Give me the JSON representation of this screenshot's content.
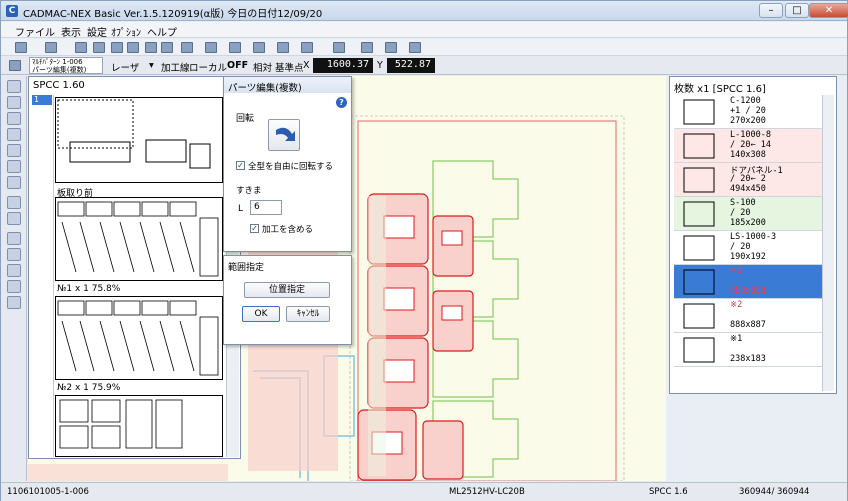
{
  "window": {
    "title": "CADMAC-NEX Basic Ver.1.5.120919(α版) 今日の日付12/09/20",
    "controls": [
      "minimize-icon",
      "maximize-icon",
      "close-icon"
    ]
  },
  "menu": [
    "ファイル",
    "表示",
    "設定",
    "ｵﾌﾟｼｮﾝ",
    "ヘルプ"
  ],
  "statusline": {
    "combo_line1": "ﾏﾙﾁﾊﾟﾀｰﾝ 1-006",
    "combo_line2": "パーツ編集(複数)",
    "machine": "レーザ",
    "processing": "加工線",
    "local": "ローカル",
    "off": "OFF",
    "relative": "相対",
    "base_point": "基準点",
    "x_label": "X",
    "x_value": "1600.37",
    "y_label": "Y",
    "y_value": "522.87"
  },
  "sheet_panel": {
    "title": "SPCC  1.60",
    "row_number": "1",
    "sheets": [
      {
        "label": "板取り前"
      },
      {
        "label": "№1  x  1    75.8%"
      },
      {
        "label": "№2  x  1    75.9%"
      }
    ]
  },
  "parts_dialog": {
    "title": "パーツ編集(複数)",
    "help": "?",
    "rotate_label": "回転",
    "rotate_free": "全型を自由に回転する",
    "offset_label": "すきま",
    "offset_prefix": "L",
    "offset_value": "6",
    "include_processing": "加工を含める"
  },
  "range_dialog": {
    "title": "範囲指定",
    "position_button": "位置指定",
    "ok": "OK",
    "cancel": "ｷｬﾝｾﾙ"
  },
  "list_panel": {
    "title": "枚数 x1 [SPCC 1.6]",
    "items": [
      {
        "name": "C-1200",
        "qty": "+1  /  20",
        "size": "270x200",
        "bg": "#ffffff",
        "color": "#000000"
      },
      {
        "name": "L-1000-8",
        "qty": " /  20←  14",
        "size": "140x308",
        "bg": "#fde7e7",
        "color": "#000000"
      },
      {
        "name": "ドアパネル-1",
        "qty": " /  20←   2",
        "size": "494x450",
        "bg": "#fde7e7",
        "color": "#000000"
      },
      {
        "name": "S-100",
        "qty": " /  20",
        "size": "185x200",
        "bg": "#e6f5df",
        "color": "#000000"
      },
      {
        "name": "LS-1000-3",
        "qty": " /  20",
        "size": "190x192",
        "bg": "#ffffff",
        "color": "#000000"
      },
      {
        "name": "※1",
        "qty": "",
        "size": "858x858",
        "bg": "#3a7bd5",
        "color": "#ff3b3b"
      },
      {
        "name": "※2",
        "qty": "",
        "size": "888x887",
        "bg": "#ffffff",
        "color": "#c33c3c"
      },
      {
        "name": "※1",
        "qty": "",
        "size": "238x183",
        "bg": "#ffffff",
        "color": "#000000"
      }
    ]
  },
  "bottombar": {
    "left": "1106101005-1-006",
    "machine": "ML2512HV-LC20B",
    "material": "SPCC 1.6",
    "count": "360944/ 360944"
  },
  "colors": {
    "part_fill": "#f8d0cc",
    "part_stroke": "#e01a1a",
    "green_outline": "#6cc24a",
    "blue_outline": "#4aa8d8",
    "selection": "#3a7bd5"
  }
}
